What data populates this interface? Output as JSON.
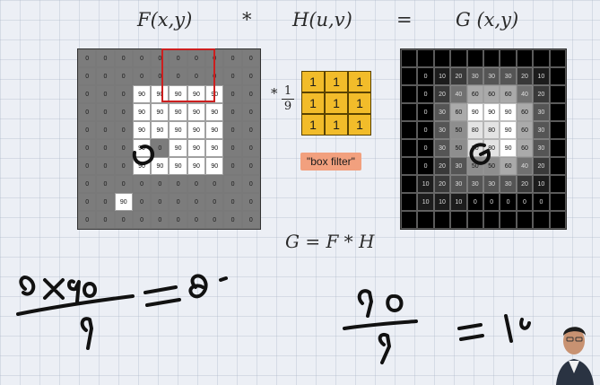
{
  "equation": {
    "f": "F(x,y)",
    "conv": "*",
    "h": "H(u,v)",
    "eq": "=",
    "g": "G (x,y)"
  },
  "input_image": {
    "rows": [
      [
        0,
        0,
        0,
        0,
        0,
        0,
        0,
        0,
        0,
        0
      ],
      [
        0,
        0,
        0,
        0,
        0,
        0,
        0,
        0,
        0,
        0
      ],
      [
        0,
        0,
        0,
        90,
        90,
        90,
        90,
        90,
        0,
        0
      ],
      [
        0,
        0,
        0,
        90,
        90,
        90,
        90,
        90,
        0,
        0
      ],
      [
        0,
        0,
        0,
        90,
        90,
        90,
        90,
        90,
        0,
        0
      ],
      [
        0,
        0,
        0,
        90,
        0,
        90,
        90,
        90,
        0,
        0
      ],
      [
        0,
        0,
        0,
        90,
        90,
        90,
        90,
        90,
        0,
        0
      ],
      [
        0,
        0,
        0,
        0,
        0,
        0,
        0,
        0,
        0,
        0
      ],
      [
        0,
        0,
        90,
        0,
        0,
        0,
        0,
        0,
        0,
        0
      ],
      [
        0,
        0,
        0,
        0,
        0,
        0,
        0,
        0,
        0,
        0
      ]
    ]
  },
  "kernel": {
    "prefix": "*",
    "numerator": "1",
    "denominator": "9",
    "values": [
      [
        1,
        1,
        1
      ],
      [
        1,
        1,
        1
      ],
      [
        1,
        1,
        1
      ]
    ],
    "label": "\"box filter\""
  },
  "output_image": {
    "rows": [
      [
        "",
        "",
        "",
        "",
        "",
        "",
        "",
        "",
        "",
        ""
      ],
      [
        "",
        "0",
        "10",
        "20",
        "30",
        "30",
        "30",
        "20",
        "10",
        ""
      ],
      [
        "",
        "0",
        "20",
        "40",
        "60",
        "60",
        "60",
        "40",
        "20",
        ""
      ],
      [
        "",
        "0",
        "30",
        "60",
        "90",
        "90",
        "90",
        "60",
        "30",
        ""
      ],
      [
        "",
        "0",
        "30",
        "50",
        "80",
        "80",
        "90",
        "60",
        "30",
        ""
      ],
      [
        "",
        "0",
        "30",
        "50",
        "80",
        "80",
        "90",
        "60",
        "30",
        ""
      ],
      [
        "",
        "0",
        "20",
        "30",
        "50",
        "50",
        "60",
        "40",
        "20",
        ""
      ],
      [
        "",
        "10",
        "20",
        "30",
        "30",
        "30",
        "30",
        "20",
        "10",
        ""
      ],
      [
        "",
        "10",
        "10",
        "10",
        "0",
        "0",
        "0",
        "0",
        "0",
        ""
      ],
      [
        "",
        "",
        "",
        "",
        "",
        "",
        "",
        "",
        "",
        ""
      ]
    ]
  },
  "formula": "G = F * H",
  "colors": {
    "kernel": "#f2bc2a",
    "label_bg": "#f2a07e",
    "highlight": "#cc1f1f",
    "ink": "#111111"
  }
}
